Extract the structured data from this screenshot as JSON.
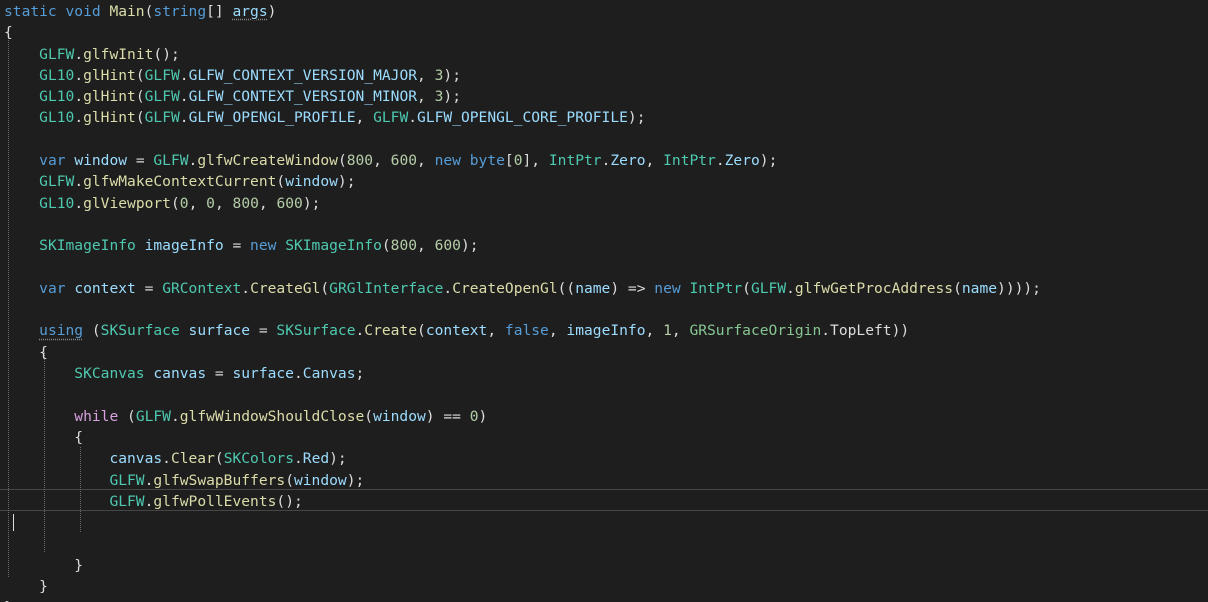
{
  "editor": {
    "language": "csharp",
    "current_line": 24,
    "lines": [
      [
        {
          "t": "static ",
          "c": "kw"
        },
        {
          "t": "void ",
          "c": "kw"
        },
        {
          "t": "Main",
          "c": "mt"
        },
        {
          "t": "(",
          "c": "pu"
        },
        {
          "t": "string",
          "c": "kw"
        },
        {
          "t": "[] ",
          "c": "pu"
        },
        {
          "t": "args",
          "c": "vr",
          "u": true
        },
        {
          "t": ")",
          "c": "pu"
        }
      ],
      [
        {
          "t": "{",
          "c": "pu"
        }
      ],
      [
        {
          "t": "    ",
          "c": "pu"
        },
        {
          "t": "GLFW",
          "c": "ty"
        },
        {
          "t": ".",
          "c": "pu"
        },
        {
          "t": "glfwInit",
          "c": "mt"
        },
        {
          "t": "();",
          "c": "pu"
        }
      ],
      [
        {
          "t": "    ",
          "c": "pu"
        },
        {
          "t": "GL10",
          "c": "ty"
        },
        {
          "t": ".",
          "c": "pu"
        },
        {
          "t": "glHint",
          "c": "mt"
        },
        {
          "t": "(",
          "c": "pu"
        },
        {
          "t": "GLFW",
          "c": "ty"
        },
        {
          "t": ".",
          "c": "pu"
        },
        {
          "t": "GLFW_CONTEXT_VERSION_MAJOR",
          "c": "pr"
        },
        {
          "t": ", ",
          "c": "pu"
        },
        {
          "t": "3",
          "c": "nm"
        },
        {
          "t": ");",
          "c": "pu"
        }
      ],
      [
        {
          "t": "    ",
          "c": "pu"
        },
        {
          "t": "GL10",
          "c": "ty"
        },
        {
          "t": ".",
          "c": "pu"
        },
        {
          "t": "glHint",
          "c": "mt"
        },
        {
          "t": "(",
          "c": "pu"
        },
        {
          "t": "GLFW",
          "c": "ty"
        },
        {
          "t": ".",
          "c": "pu"
        },
        {
          "t": "GLFW_CONTEXT_VERSION_MINOR",
          "c": "pr"
        },
        {
          "t": ", ",
          "c": "pu"
        },
        {
          "t": "3",
          "c": "nm"
        },
        {
          "t": ");",
          "c": "pu"
        }
      ],
      [
        {
          "t": "    ",
          "c": "pu"
        },
        {
          "t": "GL10",
          "c": "ty"
        },
        {
          "t": ".",
          "c": "pu"
        },
        {
          "t": "glHint",
          "c": "mt"
        },
        {
          "t": "(",
          "c": "pu"
        },
        {
          "t": "GLFW",
          "c": "ty"
        },
        {
          "t": ".",
          "c": "pu"
        },
        {
          "t": "GLFW_OPENGL_PROFILE",
          "c": "pr"
        },
        {
          "t": ", ",
          "c": "pu"
        },
        {
          "t": "GLFW",
          "c": "ty"
        },
        {
          "t": ".",
          "c": "pu"
        },
        {
          "t": "GLFW_OPENGL_CORE_PROFILE",
          "c": "pr"
        },
        {
          "t": ");",
          "c": "pu"
        }
      ],
      [],
      [
        {
          "t": "    ",
          "c": "pu"
        },
        {
          "t": "var ",
          "c": "kw"
        },
        {
          "t": "window",
          "c": "vr"
        },
        {
          "t": " = ",
          "c": "pu"
        },
        {
          "t": "GLFW",
          "c": "ty"
        },
        {
          "t": ".",
          "c": "pu"
        },
        {
          "t": "glfwCreateWindow",
          "c": "mt"
        },
        {
          "t": "(",
          "c": "pu"
        },
        {
          "t": "800",
          "c": "nm"
        },
        {
          "t": ", ",
          "c": "pu"
        },
        {
          "t": "600",
          "c": "nm"
        },
        {
          "t": ", ",
          "c": "pu"
        },
        {
          "t": "new ",
          "c": "kw"
        },
        {
          "t": "byte",
          "c": "kw"
        },
        {
          "t": "[",
          "c": "pu"
        },
        {
          "t": "0",
          "c": "nm"
        },
        {
          "t": "], ",
          "c": "pu"
        },
        {
          "t": "IntPtr",
          "c": "ty"
        },
        {
          "t": ".",
          "c": "pu"
        },
        {
          "t": "Zero",
          "c": "pr"
        },
        {
          "t": ", ",
          "c": "pu"
        },
        {
          "t": "IntPtr",
          "c": "ty"
        },
        {
          "t": ".",
          "c": "pu"
        },
        {
          "t": "Zero",
          "c": "pr"
        },
        {
          "t": ");",
          "c": "pu"
        }
      ],
      [
        {
          "t": "    ",
          "c": "pu"
        },
        {
          "t": "GLFW",
          "c": "ty"
        },
        {
          "t": ".",
          "c": "pu"
        },
        {
          "t": "glfwMakeContextCurrent",
          "c": "mt"
        },
        {
          "t": "(",
          "c": "pu"
        },
        {
          "t": "window",
          "c": "vr"
        },
        {
          "t": ");",
          "c": "pu"
        }
      ],
      [
        {
          "t": "    ",
          "c": "pu"
        },
        {
          "t": "GL10",
          "c": "ty"
        },
        {
          "t": ".",
          "c": "pu"
        },
        {
          "t": "glViewport",
          "c": "mt"
        },
        {
          "t": "(",
          "c": "pu"
        },
        {
          "t": "0",
          "c": "nm"
        },
        {
          "t": ", ",
          "c": "pu"
        },
        {
          "t": "0",
          "c": "nm"
        },
        {
          "t": ", ",
          "c": "pu"
        },
        {
          "t": "800",
          "c": "nm"
        },
        {
          "t": ", ",
          "c": "pu"
        },
        {
          "t": "600",
          "c": "nm"
        },
        {
          "t": ");",
          "c": "pu"
        }
      ],
      [],
      [
        {
          "t": "    ",
          "c": "pu"
        },
        {
          "t": "SKImageInfo",
          "c": "ty"
        },
        {
          "t": " ",
          "c": "pu"
        },
        {
          "t": "imageInfo",
          "c": "vr"
        },
        {
          "t": " = ",
          "c": "pu"
        },
        {
          "t": "new ",
          "c": "kw"
        },
        {
          "t": "SKImageInfo",
          "c": "ty"
        },
        {
          "t": "(",
          "c": "pu"
        },
        {
          "t": "800",
          "c": "nm"
        },
        {
          "t": ", ",
          "c": "pu"
        },
        {
          "t": "600",
          "c": "nm"
        },
        {
          "t": ");",
          "c": "pu"
        }
      ],
      [],
      [
        {
          "t": "    ",
          "c": "pu"
        },
        {
          "t": "var ",
          "c": "kw"
        },
        {
          "t": "context",
          "c": "vr"
        },
        {
          "t": " = ",
          "c": "pu"
        },
        {
          "t": "GRContext",
          "c": "ty"
        },
        {
          "t": ".",
          "c": "pu"
        },
        {
          "t": "CreateGl",
          "c": "mt"
        },
        {
          "t": "(",
          "c": "pu"
        },
        {
          "t": "GRGlInterface",
          "c": "ty"
        },
        {
          "t": ".",
          "c": "pu"
        },
        {
          "t": "CreateOpenGl",
          "c": "mt"
        },
        {
          "t": "((",
          "c": "pu"
        },
        {
          "t": "name",
          "c": "vr"
        },
        {
          "t": ") => ",
          "c": "pu"
        },
        {
          "t": "new ",
          "c": "kw"
        },
        {
          "t": "IntPtr",
          "c": "ty"
        },
        {
          "t": "(",
          "c": "pu"
        },
        {
          "t": "GLFW",
          "c": "ty"
        },
        {
          "t": ".",
          "c": "pu"
        },
        {
          "t": "glfwGetProcAddress",
          "c": "mt"
        },
        {
          "t": "(",
          "c": "pu"
        },
        {
          "t": "name",
          "c": "vr"
        },
        {
          "t": "))));",
          "c": "pu"
        }
      ],
      [],
      [
        {
          "t": "    ",
          "c": "pu"
        },
        {
          "t": "using",
          "c": "kw",
          "u": true
        },
        {
          "t": " (",
          "c": "pu"
        },
        {
          "t": "SKSurface",
          "c": "ty"
        },
        {
          "t": " ",
          "c": "pu"
        },
        {
          "t": "surface",
          "c": "vr"
        },
        {
          "t": " = ",
          "c": "pu"
        },
        {
          "t": "SKSurface",
          "c": "ty"
        },
        {
          "t": ".",
          "c": "pu"
        },
        {
          "t": "Create",
          "c": "mt"
        },
        {
          "t": "(",
          "c": "pu"
        },
        {
          "t": "context",
          "c": "vr"
        },
        {
          "t": ", ",
          "c": "pu"
        },
        {
          "t": "false",
          "c": "kw"
        },
        {
          "t": ", ",
          "c": "pu"
        },
        {
          "t": "imageInfo",
          "c": "vr"
        },
        {
          "t": ", ",
          "c": "pu"
        },
        {
          "t": "1",
          "c": "nm"
        },
        {
          "t": ", ",
          "c": "pu"
        },
        {
          "t": "GRSurfaceOrigin",
          "c": "ty2"
        },
        {
          "t": ".",
          "c": "pu"
        },
        {
          "t": "TopLeft",
          "c": "pu"
        },
        {
          "t": "))",
          "c": "pu"
        }
      ],
      [
        {
          "t": "    {",
          "c": "pu"
        }
      ],
      [
        {
          "t": "        ",
          "c": "pu"
        },
        {
          "t": "SKCanvas",
          "c": "ty"
        },
        {
          "t": " ",
          "c": "pu"
        },
        {
          "t": "canvas",
          "c": "vr"
        },
        {
          "t": " = ",
          "c": "pu"
        },
        {
          "t": "surface",
          "c": "vr"
        },
        {
          "t": ".",
          "c": "pu"
        },
        {
          "t": "Canvas",
          "c": "pr"
        },
        {
          "t": ";",
          "c": "pu"
        }
      ],
      [],
      [
        {
          "t": "        ",
          "c": "pu"
        },
        {
          "t": "while",
          "c": "kw2"
        },
        {
          "t": " (",
          "c": "pu"
        },
        {
          "t": "GLFW",
          "c": "ty"
        },
        {
          "t": ".",
          "c": "pu"
        },
        {
          "t": "glfwWindowShouldClose",
          "c": "mt"
        },
        {
          "t": "(",
          "c": "pu"
        },
        {
          "t": "window",
          "c": "vr"
        },
        {
          "t": ") == ",
          "c": "pu"
        },
        {
          "t": "0",
          "c": "nm"
        },
        {
          "t": ")",
          "c": "pu"
        }
      ],
      [
        {
          "t": "        {",
          "c": "pu"
        }
      ],
      [
        {
          "t": "            ",
          "c": "pu"
        },
        {
          "t": "canvas",
          "c": "vr"
        },
        {
          "t": ".",
          "c": "pu"
        },
        {
          "t": "Clear",
          "c": "mt"
        },
        {
          "t": "(",
          "c": "pu"
        },
        {
          "t": "SKColors",
          "c": "ty"
        },
        {
          "t": ".",
          "c": "pu"
        },
        {
          "t": "Red",
          "c": "pr"
        },
        {
          "t": ");",
          "c": "pu"
        }
      ],
      [
        {
          "t": "            ",
          "c": "pu"
        },
        {
          "t": "GLFW",
          "c": "ty"
        },
        {
          "t": ".",
          "c": "pu"
        },
        {
          "t": "glfwSwapBuffers",
          "c": "mt"
        },
        {
          "t": "(",
          "c": "pu"
        },
        {
          "t": "window",
          "c": "vr"
        },
        {
          "t": ");",
          "c": "pu"
        }
      ],
      [
        {
          "t": "            ",
          "c": "pu"
        },
        {
          "t": "GLFW",
          "c": "ty"
        },
        {
          "t": ".",
          "c": "pu"
        },
        {
          "t": "glfwPollEvents",
          "c": "mt"
        },
        {
          "t": "();",
          "c": "pu"
        }
      ],
      [],
      [],
      [
        {
          "t": "        }",
          "c": "pu"
        }
      ],
      [
        {
          "t": "    }",
          "c": "pu"
        }
      ],
      [
        {
          "t": "}",
          "c": "pu"
        }
      ]
    ]
  },
  "colors": {
    "background": "#1e1e1e",
    "keyword": "#569cd6",
    "control_keyword": "#d8a0df",
    "type": "#4ec9b0",
    "enum_type": "#86c691",
    "method": "#dcdcaa",
    "variable": "#9cdcfe",
    "number": "#b5cea8",
    "text": "#dcdcdc"
  }
}
